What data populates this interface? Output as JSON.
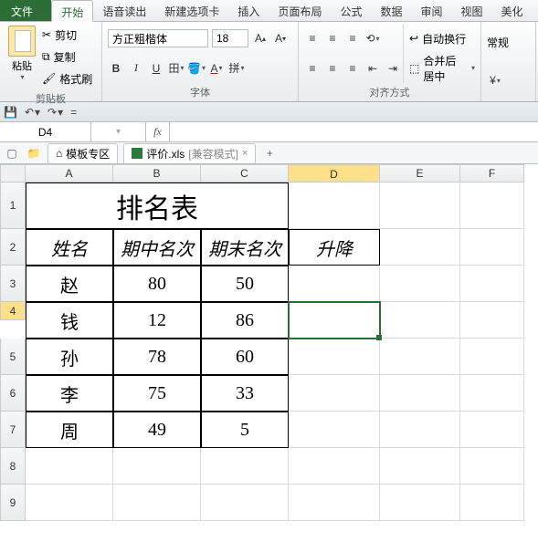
{
  "tabs": {
    "file": "文件",
    "home": "开始",
    "voice": "语音读出",
    "newtab": "新建选项卡",
    "insert": "插入",
    "layout": "页面布局",
    "formula": "公式",
    "data": "数据",
    "review": "审阅",
    "view": "视图",
    "beautify": "美化"
  },
  "ribbon": {
    "clipboard": {
      "paste": "粘贴",
      "cut": "剪切",
      "copy": "复制",
      "format_painter": "格式刷",
      "label": "剪贴板"
    },
    "font": {
      "name": "方正粗楷体",
      "size": "18",
      "bold": "B",
      "italic": "I",
      "underline": "U",
      "label": "字体"
    },
    "align": {
      "wrap": "自动换行",
      "merge": "合并后居中",
      "label": "对齐方式"
    },
    "number_label": "常规"
  },
  "namebox": "D4",
  "formula": "",
  "sheettabs": {
    "template": "模板专区",
    "file": "评价.xls",
    "mode": "[兼容模式]"
  },
  "cols": [
    "A",
    "B",
    "C",
    "D",
    "E",
    "F"
  ],
  "rows": [
    "1",
    "2",
    "3",
    "4",
    "5",
    "6",
    "7",
    "8",
    "9"
  ],
  "table": {
    "title": "排名表",
    "headers": {
      "a": "姓名",
      "b": "期中名次",
      "c": "期末名次",
      "d": "升降"
    },
    "r3": {
      "a": "赵",
      "b": "80",
      "c": "50"
    },
    "r4": {
      "a": "钱",
      "b": "12",
      "c": "86",
      "d": ""
    },
    "r5": {
      "a": "孙",
      "b": "78",
      "c": "60"
    },
    "r6": {
      "a": "李",
      "b": "75",
      "c": "33"
    },
    "r7": {
      "a": "周",
      "b": "49",
      "c": "5"
    }
  },
  "chart_data": {
    "type": "table",
    "title": "排名表",
    "columns": [
      "姓名",
      "期中名次",
      "期末名次",
      "升降"
    ],
    "rows": [
      [
        "赵",
        80,
        50,
        null
      ],
      [
        "钱",
        12,
        86,
        null
      ],
      [
        "孙",
        78,
        60,
        null
      ],
      [
        "李",
        75,
        33,
        null
      ],
      [
        "周",
        49,
        5,
        null
      ]
    ]
  }
}
